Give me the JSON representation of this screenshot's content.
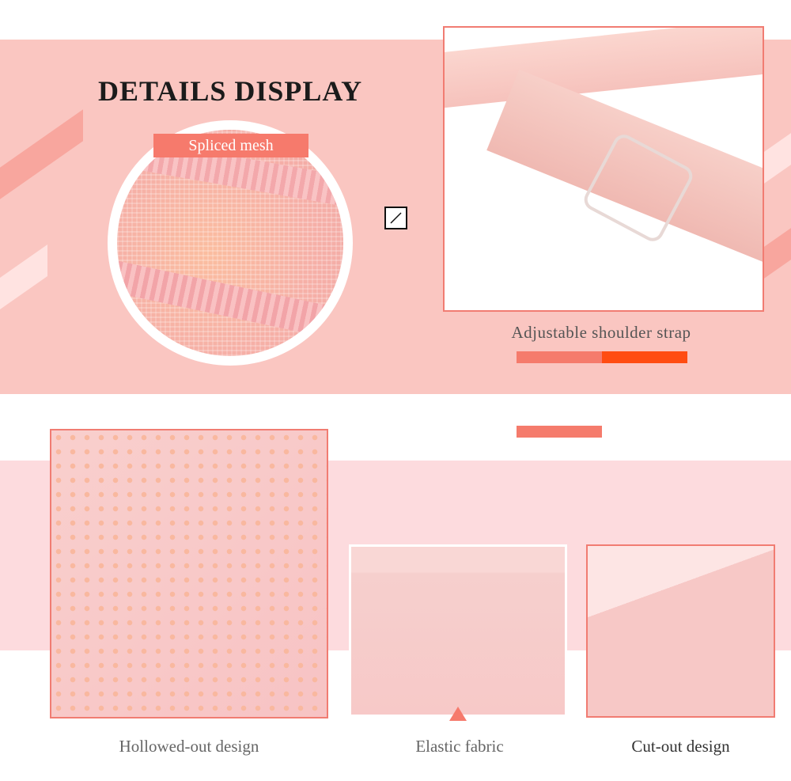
{
  "page": {
    "title": "DETAILS DISPLAY"
  },
  "details": {
    "spliced_mesh": {
      "label": "Spliced mesh"
    },
    "shoulder_strap": {
      "caption": "Adjustable shoulder strap"
    },
    "hollowed_out": {
      "caption": "Hollowed-out design"
    },
    "elastic_fabric": {
      "caption": "Elastic fabric"
    },
    "cut_out": {
      "caption": "Cut-out design"
    }
  },
  "colors": {
    "top_band": "#fac6c1",
    "bottom_band": "#fddbde",
    "accent": "#f67a6c",
    "accent_strong": "#ff4c12",
    "frame": "#f17c72"
  },
  "icons": {
    "small_icon": "slash-square-icon"
  }
}
